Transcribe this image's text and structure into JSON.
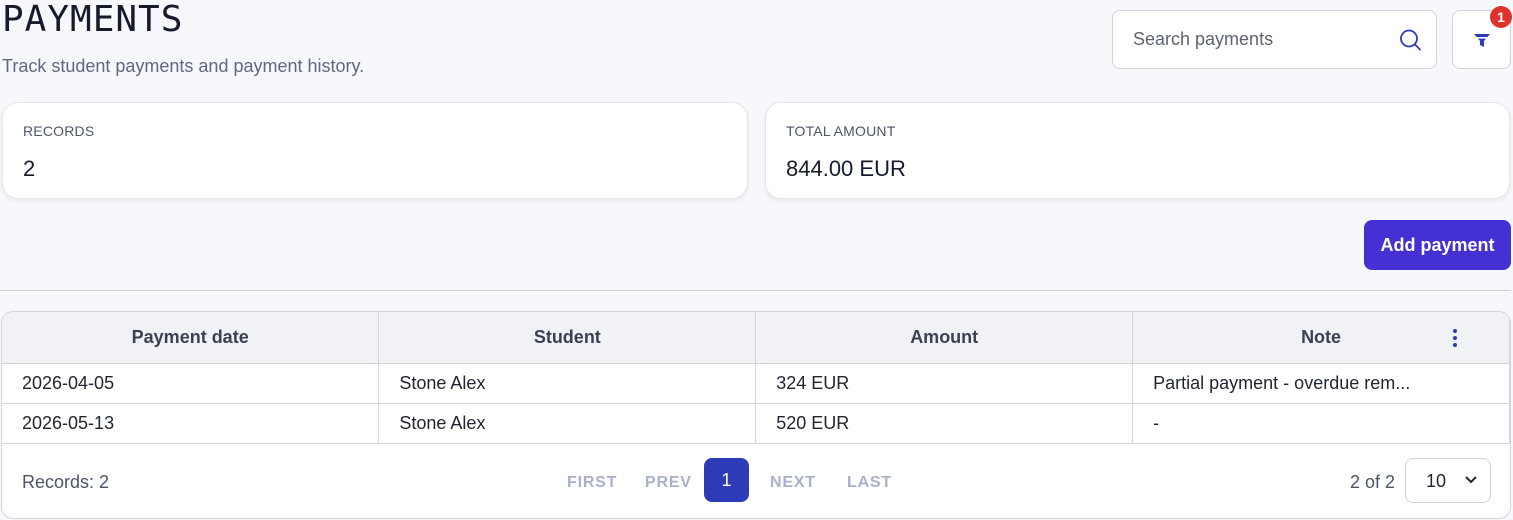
{
  "header": {
    "title": "PAYMENTS",
    "subtitle": "Track student payments and payment history."
  },
  "search": {
    "placeholder": "Search payments",
    "value": "",
    "icon": "search-icon"
  },
  "filter": {
    "icon": "funnel-icon",
    "badge": "1",
    "badge_color": "#e0322d"
  },
  "stats": {
    "records": {
      "label": "RECORDS",
      "value": "2"
    },
    "total": {
      "label": "TOTAL AMOUNT",
      "value": "844.00 EUR"
    }
  },
  "actions": {
    "add_label": "Add payment",
    "accent": "#4431d4"
  },
  "table": {
    "columns": [
      "Payment date",
      "Student",
      "Amount",
      "Note"
    ],
    "menu_icon": "kebab-menu-icon",
    "rows": [
      {
        "date": "2026-04-05",
        "student": "Stone Alex",
        "amount": "324 EUR",
        "note": "Partial payment - overdue rem..."
      },
      {
        "date": "2026-05-13",
        "student": "Stone Alex",
        "amount": "520 EUR",
        "note": "-"
      }
    ]
  },
  "footer": {
    "records_text": "Records: 2",
    "pager": {
      "first": "FIRST",
      "prev": "PREV",
      "current": "1",
      "next": "NEXT",
      "last": "LAST",
      "current_color": "#2e3bb7"
    },
    "page_range": "2 of 2",
    "page_size": "10"
  }
}
